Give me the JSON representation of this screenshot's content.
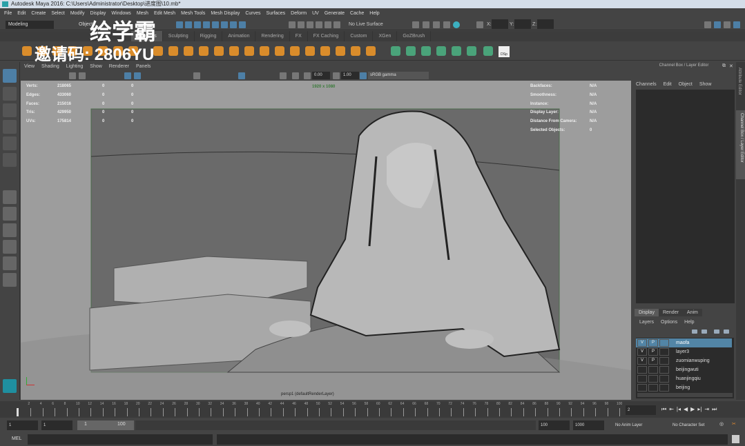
{
  "window": {
    "title": "Autodesk Maya 2016: C:\\Users\\Administrator\\Desktop\\进度图\\10.mb*"
  },
  "menu": [
    "File",
    "Edit",
    "Create",
    "Select",
    "Modify",
    "Display",
    "Windows",
    "Mesh",
    "Edit Mesh",
    "Mesh Tools",
    "Mesh Display",
    "Curves",
    "Surfaces",
    "Deform",
    "UV",
    "Generate",
    "Cache",
    "Help"
  ],
  "status": {
    "mode": "Modeling",
    "objects": "Objects",
    "live_surface": "No Live Surface",
    "x_label": "X:",
    "y_label": "Y:",
    "z_label": "Z:"
  },
  "shelf_tabs": [
    "Curves / Surfaces",
    "Polygons",
    "Sculpting",
    "Rigging",
    "Animation",
    "Rendering",
    "FX",
    "FX Caching",
    "Custom",
    "XGen",
    "GoZBrush"
  ],
  "shelf": {
    "dsp_label": "DSp"
  },
  "watermark": {
    "brand": "绘学霸",
    "invite": "邀请码: 2806YU"
  },
  "viewport": {
    "menu": [
      "View",
      "Shading",
      "Lighting",
      "Show",
      "Renderer",
      "Panels"
    ],
    "exposure": "0.00",
    "gamma": "1.00",
    "color_space": "sRGB gamma",
    "resolution": "1920 x 1080",
    "camera_label": "persp1 (defaultRenderLayer)",
    "stats": [
      {
        "label": "Verts:",
        "a": "218065",
        "b": "0",
        "c": "0"
      },
      {
        "label": "Edges:",
        "a": "433060",
        "b": "0",
        "c": "0"
      },
      {
        "label": "Faces:",
        "a": "215016",
        "b": "0",
        "c": "0"
      },
      {
        "label": "Tris:",
        "a": "429950",
        "b": "0",
        "c": "0"
      },
      {
        "label": "UVs:",
        "a": "175814",
        "b": "0",
        "c": "0"
      }
    ],
    "info": [
      {
        "label": "Backfaces:",
        "value": "N/A"
      },
      {
        "label": "Smoothness:",
        "value": "N/A"
      },
      {
        "label": "Instance:",
        "value": "N/A"
      },
      {
        "label": "Display Layer:",
        "value": "N/A"
      },
      {
        "label": "Distance From Camera:",
        "value": "N/A"
      },
      {
        "label": "Selected Objects:",
        "value": "0"
      }
    ]
  },
  "channel_box": {
    "title": "Channel Box / Layer Editor",
    "menu": [
      "Channels",
      "Edit",
      "Object",
      "Show"
    ]
  },
  "side_tabs": [
    "Attribute Editor",
    "Channel Box / Layer Editor"
  ],
  "layer_editor": {
    "tabs": [
      "Display",
      "Render",
      "Anim"
    ],
    "menu": [
      "Layers",
      "Options",
      "Help"
    ],
    "layers": [
      {
        "name": "maofa",
        "v": "V",
        "p": "P",
        "selected": true
      },
      {
        "name": "layer3",
        "v": "V",
        "p": "P",
        "selected": false
      },
      {
        "name": "zuomianwuping",
        "v": "V",
        "p": "P",
        "selected": false
      },
      {
        "name": "beijingwuti",
        "v": "",
        "p": "",
        "selected": false
      },
      {
        "name": "huanjingqiu",
        "v": "",
        "p": "",
        "selected": false
      },
      {
        "name": "beijing",
        "v": "",
        "p": "",
        "selected": false
      }
    ]
  },
  "timeline": {
    "ticks": [
      "2",
      "4",
      "6",
      "8",
      "10",
      "12",
      "14",
      "16",
      "18",
      "20",
      "22",
      "24",
      "26",
      "28",
      "30",
      "32",
      "34",
      "36",
      "38",
      "40",
      "42",
      "44",
      "46",
      "48",
      "50",
      "52",
      "54",
      "56",
      "58",
      "60",
      "62",
      "64",
      "66",
      "68",
      "70",
      "72",
      "74",
      "76",
      "78",
      "80",
      "82",
      "84",
      "86",
      "88",
      "90",
      "92",
      "94",
      "96",
      "98",
      "100"
    ],
    "current_frame": "2"
  },
  "range": {
    "start": "1",
    "playback_start": "1",
    "slider_start": "1",
    "slider_end": "100",
    "playback_end": "100",
    "end": "1000",
    "anim_layer": "No Anim Layer",
    "character_set": "No Character Set"
  },
  "command": {
    "label": "MEL"
  },
  "colors": {
    "accent": "#5285a6",
    "shelf_orange": "#d98c2b",
    "shelf_green": "#4aa37a"
  }
}
